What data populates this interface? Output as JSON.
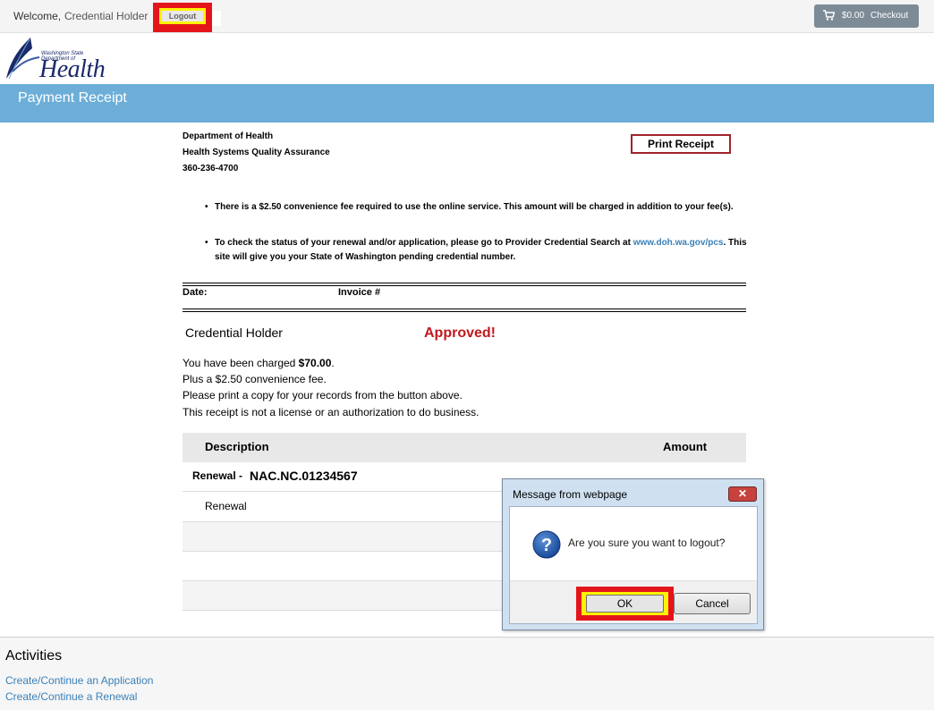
{
  "topbar": {
    "welcome": "Welcome,",
    "user_name": "Credential Holder",
    "logout_label": "Logout",
    "cart_amount": "$0.00",
    "checkout_label": "Checkout"
  },
  "logo": {
    "small_text": "Washington State Department of",
    "big_text": "Health"
  },
  "header": {
    "title": "Payment Receipt"
  },
  "receipt": {
    "org_lines": [
      "Department of Health",
      "Health Systems Quality Assurance",
      "360-236-4700"
    ],
    "print_label": "Print Receipt",
    "bullets": [
      {
        "text": "There is a $2.50 convenience fee required to use the online service. This amount will be charged in addition to your fee(s)."
      },
      {
        "text_before": "To check the status of your renewal and/or application, please go to Provider Credential Search at ",
        "link": "www.doh.wa.gov/pcs",
        "text_after": ". This site will give you your State of Washington pending credential number."
      }
    ],
    "date_label": "Date:",
    "invoice_label": "Invoice #",
    "holder": "Credential Holder",
    "status": "Approved!",
    "charged_prefix": "You have been charged ",
    "charged_amount": "$70.00",
    "charged_suffix": ".",
    "messages": [
      "Plus a $2.50 convenience fee.",
      "Please print a copy for your records from the button above.",
      "This receipt is not a license or an authorization to do business."
    ],
    "table": {
      "col_description": "Description",
      "col_amount": "Amount",
      "renewal_label": "Renewal -",
      "renewal_code": "NAC.NC.01234567",
      "renewal_sub": "Renewal"
    }
  },
  "activities": {
    "title": "Activities",
    "links": [
      "Create/Continue an Application",
      "Create/Continue a Renewal"
    ]
  },
  "dialog": {
    "title": "Message from webpage",
    "close": "✕",
    "message": "Are you sure you want to logout?",
    "ok": "OK",
    "cancel": "Cancel"
  },
  "colors": {
    "header_blue": "#6caed8",
    "approved_red": "#c0191f",
    "highlight_red": "#e3151b",
    "highlight_yellow": "#fff200",
    "link_blue": "#3a80b8"
  },
  "icons": [
    "cart-icon",
    "question-icon",
    "close-icon",
    "feather-logo-icon"
  ]
}
